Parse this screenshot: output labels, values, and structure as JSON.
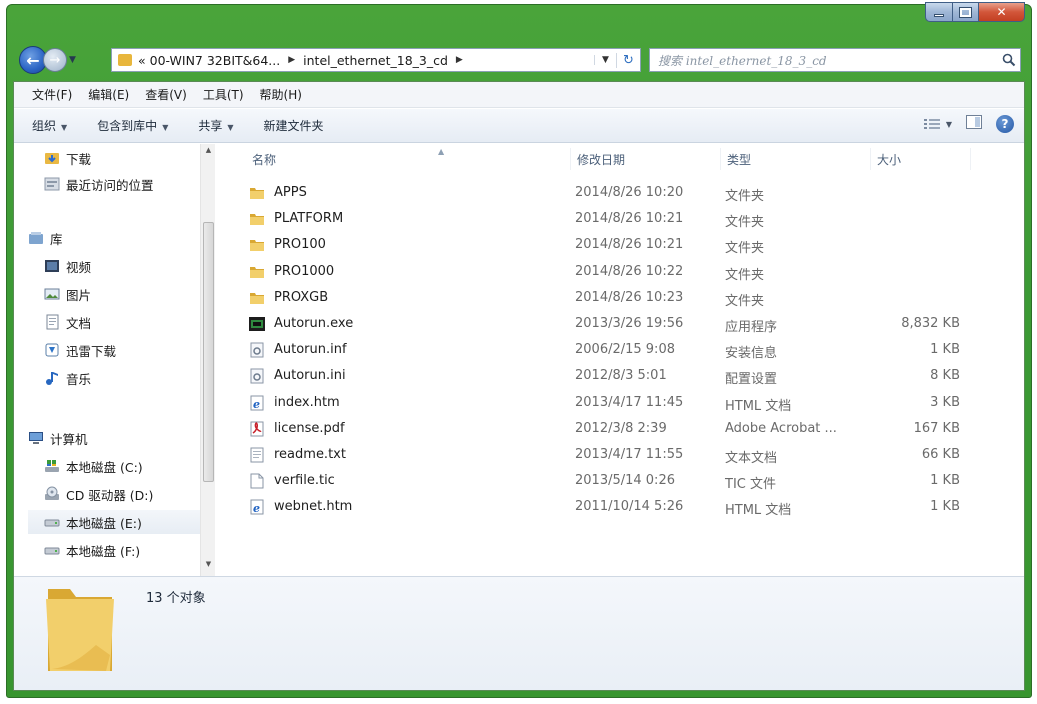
{
  "nav": {
    "address": [
      "« 00-WIN7 32BIT&64...",
      "intel_ethernet_18_3_cd"
    ],
    "search_placeholder": "搜索 intel_ethernet_18_3_cd"
  },
  "menu": [
    "文件(F)",
    "编辑(E)",
    "查看(V)",
    "工具(T)",
    "帮助(H)"
  ],
  "commands": [
    {
      "label": "组织",
      "dropdown": true
    },
    {
      "label": "包含到库中",
      "dropdown": true
    },
    {
      "label": "共享",
      "dropdown": true
    },
    {
      "label": "新建文件夹",
      "dropdown": false
    }
  ],
  "sidebar": [
    {
      "label": "下载",
      "icon": "download-folder-icon"
    },
    {
      "label": "最近访问的位置",
      "icon": "recent-places-icon"
    },
    {
      "label": "库",
      "icon": "libraries-icon"
    },
    {
      "label": "视频",
      "icon": "video-library-icon"
    },
    {
      "label": "图片",
      "icon": "pictures-library-icon"
    },
    {
      "label": "文档",
      "icon": "documents-library-icon"
    },
    {
      "label": "迅雷下载",
      "icon": "thunder-download-icon"
    },
    {
      "label": "音乐",
      "icon": "music-library-icon"
    },
    {
      "label": "计算机",
      "icon": "computer-icon"
    },
    {
      "label": "本地磁盘 (C:)",
      "icon": "system-drive-icon"
    },
    {
      "label": "CD 驱动器 (D:)",
      "icon": "cd-drive-icon"
    },
    {
      "label": "本地磁盘 (E:)",
      "icon": "local-drive-icon",
      "selected": true
    },
    {
      "label": "本地磁盘 (F:)",
      "icon": "local-drive-icon"
    }
  ],
  "columns": [
    "名称",
    "修改日期",
    "类型",
    "大小"
  ],
  "files": [
    {
      "name": "APPS",
      "date": "2014/8/26 10:20",
      "type": "文件夹",
      "size": "",
      "icon": "folder-icon"
    },
    {
      "name": "PLATFORM",
      "date": "2014/8/26 10:21",
      "type": "文件夹",
      "size": "",
      "icon": "folder-icon"
    },
    {
      "name": "PRO100",
      "date": "2014/8/26 10:21",
      "type": "文件夹",
      "size": "",
      "icon": "folder-icon"
    },
    {
      "name": "PRO1000",
      "date": "2014/8/26 10:22",
      "type": "文件夹",
      "size": "",
      "icon": "folder-icon"
    },
    {
      "name": "PROXGB",
      "date": "2014/8/26 10:23",
      "type": "文件夹",
      "size": "",
      "icon": "folder-icon"
    },
    {
      "name": "Autorun.exe",
      "date": "2013/3/26 19:56",
      "type": "应用程序",
      "size": "8,832 KB",
      "icon": "exe-icon"
    },
    {
      "name": "Autorun.inf",
      "date": "2006/2/15 9:08",
      "type": "安装信息",
      "size": "1 KB",
      "icon": "settings-file-icon"
    },
    {
      "name": "Autorun.ini",
      "date": "2012/8/3 5:01",
      "type": "配置设置",
      "size": "8 KB",
      "icon": "settings-file-icon"
    },
    {
      "name": "index.htm",
      "date": "2013/4/17 11:45",
      "type": "HTML 文档",
      "size": "3 KB",
      "icon": "html-icon"
    },
    {
      "name": "license.pdf",
      "date": "2012/3/8 2:39",
      "type": "Adobe Acrobat ...",
      "size": "167 KB",
      "icon": "pdf-icon"
    },
    {
      "name": "readme.txt",
      "date": "2013/4/17 11:55",
      "type": "文本文档",
      "size": "66 KB",
      "icon": "text-file-icon"
    },
    {
      "name": "verfile.tic",
      "date": "2013/5/14 0:26",
      "type": "TIC 文件",
      "size": "1 KB",
      "icon": "generic-file-icon"
    },
    {
      "name": "webnet.htm",
      "date": "2011/10/14 5:26",
      "type": "HTML 文档",
      "size": "1 KB",
      "icon": "html-icon"
    }
  ],
  "status": {
    "count": "13 个对象"
  }
}
